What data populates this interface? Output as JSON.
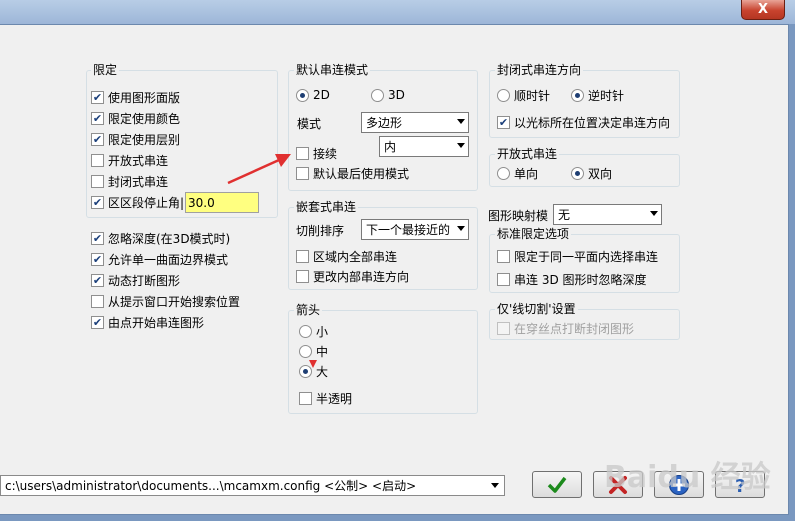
{
  "window": {
    "close_glyph": "X"
  },
  "limits": {
    "title": "限定",
    "items": [
      {
        "label": "使用图形面版",
        "checked": true
      },
      {
        "label": "限定使用颜色",
        "checked": true
      },
      {
        "label": "限定使用层别",
        "checked": true
      },
      {
        "label": "开放式串连",
        "checked": false
      },
      {
        "label": "封闭式串连",
        "checked": false
      },
      {
        "label": "区区段停止角|",
        "checked": true
      }
    ],
    "angle_value": "30.0"
  },
  "options": [
    {
      "label": "忽略深度(在3D模式时)",
      "checked": true
    },
    {
      "label": "允许单一曲面边界模式",
      "checked": true
    },
    {
      "label": "动态打断图形",
      "checked": true
    },
    {
      "label": "从提示窗口开始搜索位置",
      "checked": false
    },
    {
      "label": "由点开始串连图形",
      "checked": true
    }
  ],
  "default_mode": {
    "title": "默认串连模式",
    "radio_2d": "2D",
    "radio_3d": "3D",
    "selected": "2D",
    "mode_label": "模式",
    "mode_value": "多边形",
    "continue_label": "接续",
    "continue_value": "内",
    "last_used_label": "默认最后使用模式"
  },
  "nested": {
    "title": "嵌套式串连",
    "sort_label": "切削排序",
    "sort_value": "下一个最接近的",
    "all_in_region_label": "区域内全部串连",
    "change_dir_label": "更改内部串连方向"
  },
  "arrow": {
    "title": "箭头",
    "sizes": [
      "小",
      "中",
      "大"
    ],
    "selected": "大",
    "translucent_label": "半透明"
  },
  "closed_dir": {
    "title": "封闭式串连方向",
    "cw": "顺时针",
    "ccw": "逆时针",
    "selected": "逆时针",
    "cursor_label": "以光标所在位置决定串连方向"
  },
  "open_chain": {
    "title": "开放式串连",
    "one_way": "单向",
    "two_way": "双向",
    "selected": "双向"
  },
  "mapping": {
    "label": "图形映射模",
    "value": "无"
  },
  "standard": {
    "title": "标准限定选项",
    "same_plane": "限定于同一平面内选择串连",
    "ignore_depth": "串连 3D 图形时忽略深度"
  },
  "wire": {
    "title": "仅'线切割'设置",
    "break_closed": "在穿丝点打断封闭图形"
  },
  "footer": {
    "config_path": "c:\\users\\administrator\\documents...\\mcamxm.config <公制> <启动>"
  },
  "watermark": "Baidu 经验",
  "colors": {
    "accent": "#e03030",
    "check": "#1b3f7a",
    "highlight": "#ffff80"
  }
}
